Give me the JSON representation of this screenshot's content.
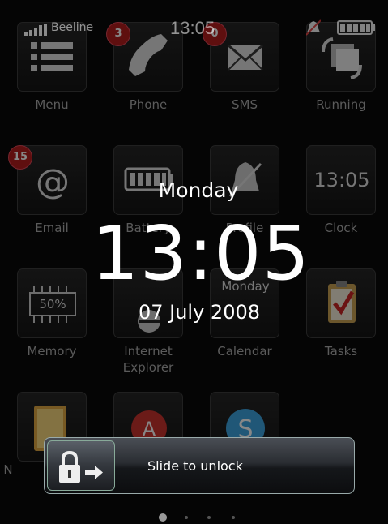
{
  "status": {
    "carrier": "Beeline",
    "time": "13:05",
    "icons": [
      "signal-icon",
      "mute-icon",
      "battery-icon"
    ]
  },
  "apps": [
    {
      "label": "Menu",
      "icon": "menu-icon"
    },
    {
      "label": "Phone",
      "icon": "phone-icon",
      "badge": "3"
    },
    {
      "label": "SMS",
      "icon": "envelope-icon",
      "badge": "0"
    },
    {
      "label": "Running",
      "icon": "windows-cycle-icon"
    },
    {
      "label": "Email",
      "icon": "at-sign-icon",
      "badge": "15"
    },
    {
      "label": "Battery",
      "icon": "battery-icon"
    },
    {
      "label": "Profile",
      "icon": "bell-muted-icon"
    },
    {
      "label": "Clock",
      "icon": "clock-icon",
      "text": "13:05"
    },
    {
      "label": "Memory",
      "icon": "memory-chip-icon",
      "text": "50%"
    },
    {
      "label": "Internet Explorer",
      "label_line1": "Internet",
      "label_line2": "Explorer",
      "icon": "ie-icon"
    },
    {
      "label": "Calendar",
      "icon": "calendar-icon",
      "text": "Monday"
    },
    {
      "label": "Tasks",
      "icon": "clipboard-check-icon"
    },
    {
      "label": "Notes",
      "visible_label": "N",
      "icon": "notes-icon"
    },
    {
      "label": "",
      "icon": "app-a-icon"
    },
    {
      "label": "",
      "icon": "skype-icon"
    }
  ],
  "lockscreen": {
    "day": "Monday",
    "time": "13:05",
    "date": "07 July 2008"
  },
  "slider": {
    "label": "Slide to unlock",
    "icon": "lock-arrow-icon"
  },
  "pager": {
    "pages": 4,
    "current": 1
  },
  "colors": {
    "badge": "#b21a1a",
    "background": "#050505",
    "text": "#ffffff"
  }
}
